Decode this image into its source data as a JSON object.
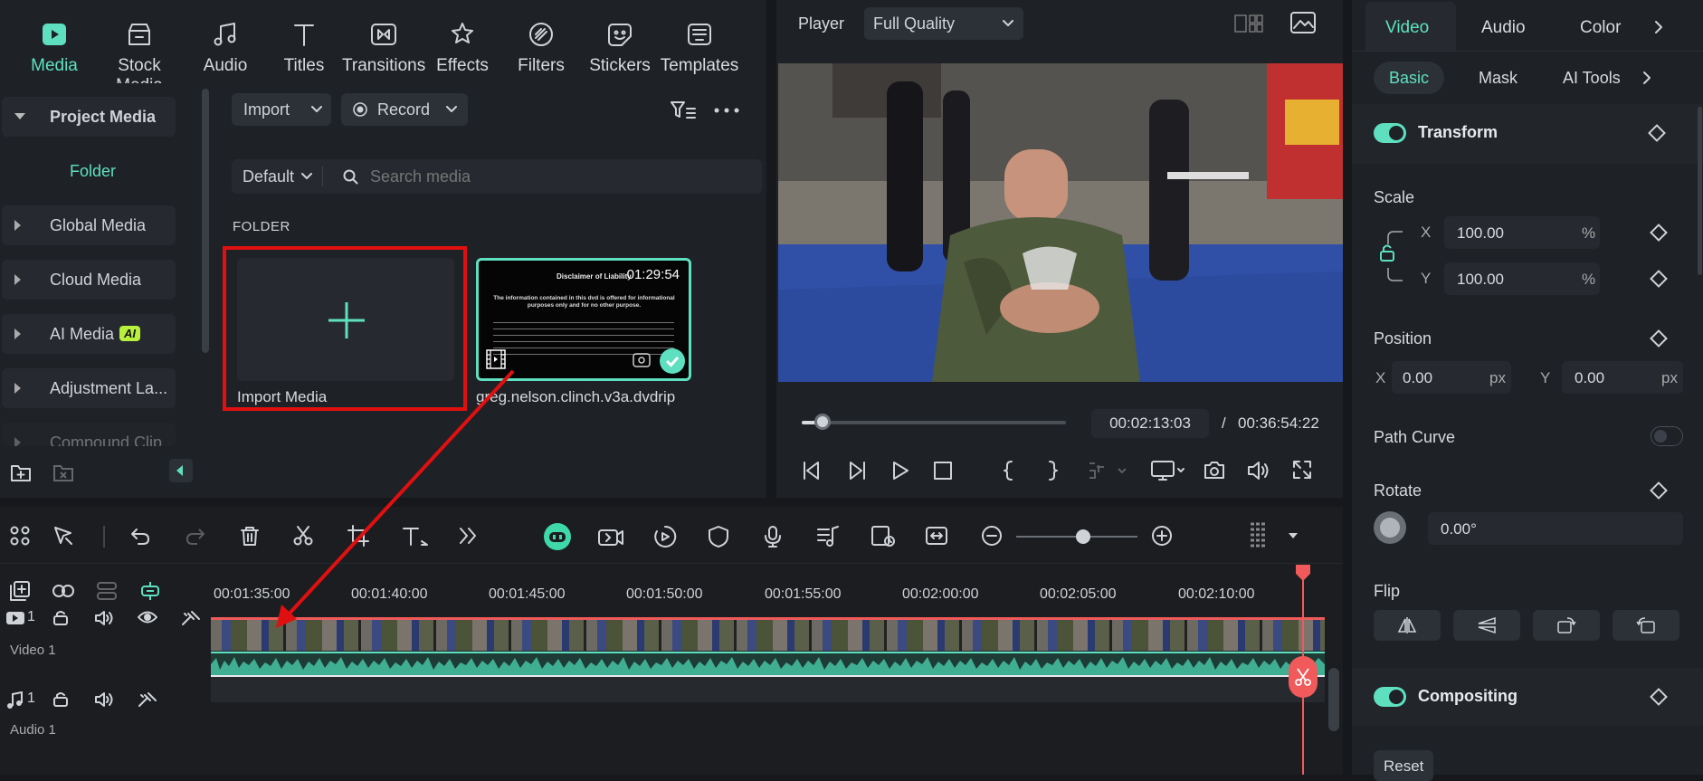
{
  "topbar": {
    "items": [
      {
        "label": "Media",
        "icon": "media-icon"
      },
      {
        "label": "Stock Media",
        "icon": "stock-media-icon"
      },
      {
        "label": "Audio",
        "icon": "audio-note-icon"
      },
      {
        "label": "Titles",
        "icon": "titles-icon"
      },
      {
        "label": "Transitions",
        "icon": "transitions-icon"
      },
      {
        "label": "Effects",
        "icon": "effects-icon"
      },
      {
        "label": "Filters",
        "icon": "filters-icon"
      },
      {
        "label": "Stickers",
        "icon": "stickers-icon"
      },
      {
        "label": "Templates",
        "icon": "templates-icon"
      }
    ]
  },
  "leftpanel": {
    "project_media": "Project Media",
    "folder": "Folder",
    "global_media": "Global Media",
    "cloud_media": "Cloud Media",
    "ai_media": "AI Media",
    "ai_badge": "AI",
    "adjustment": "Adjustment La...",
    "compound": "Compound Clip"
  },
  "media": {
    "import_label": "Import",
    "record_label": "Record",
    "sort_label": "Default",
    "search_placeholder": "Search media",
    "folder_heading": "FOLDER",
    "import_media_label": "Import Media",
    "clip_duration": "01:29:54",
    "clip_name": "greg.nelson.clinch.v3a.dvdrip",
    "clip_thumb_title": "Disclaimer of Liability",
    "clip_thumb_text": "The information contained in this dvd is offered for informational purposes only and for no other purpose."
  },
  "player": {
    "label": "Player",
    "quality": "Full Quality",
    "current_time": "00:02:13:03",
    "separator": "/",
    "total_time": "00:36:54:22",
    "progress_fraction": 0.08
  },
  "inspector": {
    "tabs": [
      "Video",
      "Audio",
      "Color"
    ],
    "subtabs": [
      "Basic",
      "Mask",
      "AI Tools"
    ],
    "transform": "Transform",
    "scale": "Scale",
    "x_label": "X",
    "y_label": "Y",
    "scale_x": "100.00",
    "scale_y": "100.00",
    "percent": "%",
    "position": "Position",
    "pos_x": "0.00",
    "pos_y": "0.00",
    "px": "px",
    "path_curve": "Path Curve",
    "rotate": "Rotate",
    "rotate_value": "0.00°",
    "flip": "Flip",
    "compositing": "Compositing",
    "reset": "Reset"
  },
  "timeline": {
    "ruler": [
      "00:01:35:00",
      "00:01:40:00",
      "00:01:45:00",
      "00:01:50:00",
      "00:01:55:00",
      "00:02:00:00",
      "00:02:05:00",
      "00:02:10:00"
    ],
    "video_track_num": "1",
    "video_track_label": "Video 1",
    "audio_track_num": "1",
    "audio_track_label": "Audio 1",
    "zoom_level": 0.55
  },
  "colors": {
    "accent": "#5ee0c0",
    "annotation_red": "#e01010",
    "playhead": "#f05a5a"
  }
}
